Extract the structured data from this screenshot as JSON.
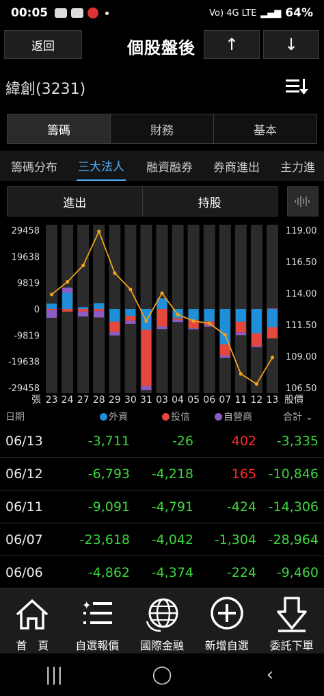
{
  "status_bar": {
    "time": "00:05",
    "network": "Vo) 4G LTE",
    "battery": "64%"
  },
  "header": {
    "back_label": "返回",
    "title": "個股盤後",
    "up_label": "↑",
    "down_label": "↓"
  },
  "stock": {
    "name": "緯創(3231)"
  },
  "main_tabs": [
    {
      "label": "籌碼"
    },
    {
      "label": "財務"
    },
    {
      "label": "基本"
    }
  ],
  "sub_tabs": [
    {
      "label": "籌碼分布"
    },
    {
      "label": "三大法人"
    },
    {
      "label": "融資融券"
    },
    {
      "label": "券商進出"
    },
    {
      "label": "主力進"
    }
  ],
  "mode_tabs": [
    {
      "label": "進出"
    },
    {
      "label": "持股"
    }
  ],
  "legend": {
    "date": "日期",
    "foreign": "外資",
    "trust": "投信",
    "dealer": "自營商",
    "total": "合計"
  },
  "colors": {
    "foreign": "#1e8fd8",
    "trust": "#e5473d",
    "dealer": "#8c5cc4",
    "price_line": "#f3a21e",
    "positive": "#ff2a2a",
    "negative": "#3dd53d"
  },
  "chart_data": {
    "type": "bar",
    "stacked": true,
    "categories": [
      "23",
      "24",
      "27",
      "28",
      "29",
      "30",
      "31",
      "03",
      "04",
      "05",
      "06",
      "07",
      "11",
      "12",
      "13"
    ],
    "x_axis_label_left": "張",
    "y_left_ticks": [
      "29458",
      "19638",
      "9819",
      "0",
      "-9819",
      "-19638",
      "-29458"
    ],
    "y_left_range": [
      -29458,
      29458
    ],
    "y_right_label": "股價",
    "y_right_ticks": [
      "119.00",
      "116.50",
      "114.00",
      "111.50",
      "109.00",
      "106.50"
    ],
    "y_right_range": [
      106.5,
      119.0
    ],
    "series": [
      {
        "name": "外資",
        "values": [
          2000,
          6000,
          700,
          2200,
          -4800,
          -2600,
          -7800,
          4000,
          -3500,
          -4200,
          -4700,
          -13200,
          -4800,
          -9091,
          -6793
        ]
      },
      {
        "name": "投信",
        "values": [
          -500,
          -1000,
          -1000,
          -800,
          -3800,
          -1800,
          -21000,
          -6500,
          -600,
          -3000,
          -1300,
          -4200,
          -4000,
          -4791,
          -4218
        ]
      },
      {
        "name": "自營商",
        "values": [
          -2800,
          2000,
          -1800,
          -2400,
          -1300,
          -1200,
          -1500,
          -1000,
          -800,
          -400,
          -600,
          -900,
          -1000,
          -424,
          165
        ]
      },
      {
        "name": "股價",
        "type": "line",
        "values": [
          113.9,
          114.9,
          116.2,
          118.9,
          115.6,
          114.3,
          111.8,
          114.0,
          112.3,
          111.8,
          111.6,
          110.7,
          107.6,
          106.8,
          108.9
        ]
      }
    ],
    "grid": false
  },
  "table": [
    {
      "date": "06/13",
      "foreign": "-3,711",
      "trust": "-26",
      "dealer": "402",
      "total": "-3,335"
    },
    {
      "date": "06/12",
      "foreign": "-6,793",
      "trust": "-4,218",
      "dealer": "165",
      "total": "-10,846"
    },
    {
      "date": "06/11",
      "foreign": "-9,091",
      "trust": "-4,791",
      "dealer": "-424",
      "total": "-14,306"
    },
    {
      "date": "06/07",
      "foreign": "-23,618",
      "trust": "-4,042",
      "dealer": "-1,304",
      "total": "-28,964"
    },
    {
      "date": "06/06",
      "foreign": "-4,862",
      "trust": "-4,374",
      "dealer": "-224",
      "total": "-9,460"
    }
  ],
  "bottom_nav": [
    {
      "label": "首　頁",
      "icon": "home-icon"
    },
    {
      "label": "自選報價",
      "icon": "list-icon"
    },
    {
      "label": "國際金融",
      "icon": "globe-icon"
    },
    {
      "label": "新增自選",
      "icon": "plus-circle-icon"
    },
    {
      "label": "委託下單",
      "icon": "download-arrow-icon"
    }
  ]
}
